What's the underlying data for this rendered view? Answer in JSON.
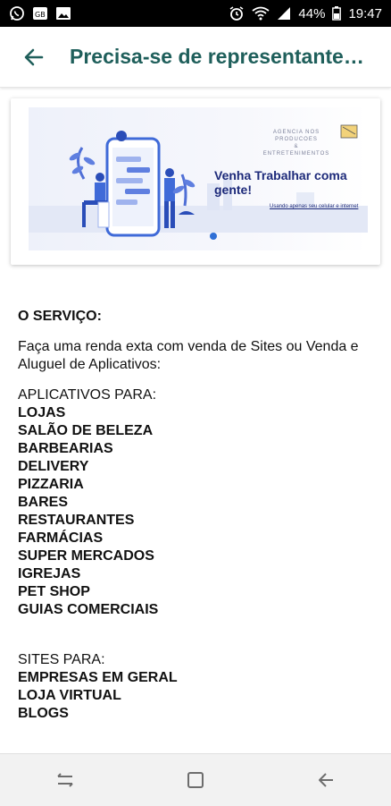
{
  "status_bar": {
    "battery": "44%",
    "time": "19:47"
  },
  "app_bar": {
    "title": "Precisa-se de representante ..."
  },
  "banner": {
    "brand_line1": "AGENCIA NOS PRODUCOES",
    "brand_line2": "&",
    "brand_line3": "ENTRETENIMENTOS",
    "headline": "Venha  Trabalhar coma gente!",
    "subline": "Usando apenas seu celular e internet"
  },
  "content": {
    "service_heading": "O SERVIÇO:",
    "service_desc": "Faça uma renda exta com venda de Sites ou Venda e Aluguel de Aplicativos:",
    "apps_heading": "APLICATIVOS PARA:",
    "apps": [
      "LOJAS",
      "SALÃO DE BELEZA",
      "BARBEARIAS",
      "DELIVERY",
      "PIZZARIA",
      "BARES",
      "RESTAURANTES",
      "FARMÁCIAS",
      "SUPER MERCADOS",
      "IGREJAS",
      "PET SHOP",
      "GUIAS COMERCIAIS"
    ],
    "sites_heading": "SITES PARA:",
    "sites": [
      "EMPRESAS EM GERAL",
      "LOJA VIRTUAL",
      "BLOGS"
    ]
  },
  "colors": {
    "title_teal": "#1f5f5b",
    "banner_navy": "#1d2a7a",
    "accent_blue": "#2f6fd6"
  },
  "icons": {
    "status_left": [
      "whatsapp-icon",
      "sd-card-icon",
      "image-icon"
    ],
    "status_right": [
      "alarm-icon",
      "wifi-icon",
      "signal-icon",
      "battery-icon"
    ],
    "nav": [
      "recent-apps-icon",
      "home-icon",
      "back-icon"
    ]
  }
}
